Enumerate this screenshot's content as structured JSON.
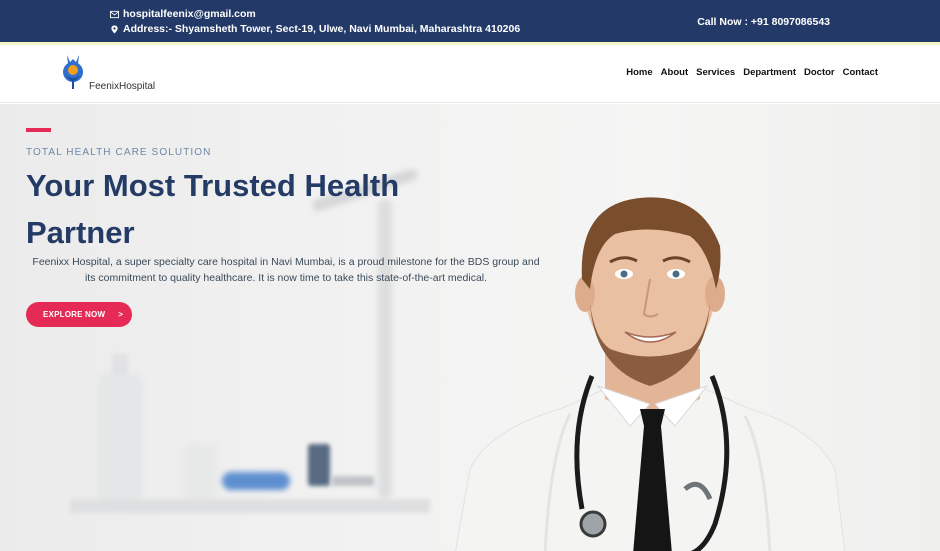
{
  "topbar": {
    "email": "hospitalfeenix@gmail.com",
    "address": "Address:- Shyamsheth Tower, Sect-19, Ulwe, Navi Mumbai, Maharashtra 410206",
    "call": "Call Now : +91 8097086543"
  },
  "brand": {
    "name": "FeenixHospital"
  },
  "nav": {
    "items": [
      "Home",
      "About",
      "Services",
      "Department",
      "Doctor",
      "Contact"
    ]
  },
  "hero": {
    "tagline": "TOTAL HEALTH CARE SOLUTION",
    "title": "Your Most Trusted Health Partner",
    "description": "Feenixx Hospital, a super specialty care hospital in Navi Mumbai, is a proud milestone for the BDS group and its commitment to quality healthcare. It is now time to take this state-of-the-art medical.",
    "cta": "EXPLORE NOW",
    "cta_arrow": ">"
  },
  "colors": {
    "topbar": "#233a68",
    "accent": "#e52a56",
    "heading": "#243b66"
  }
}
